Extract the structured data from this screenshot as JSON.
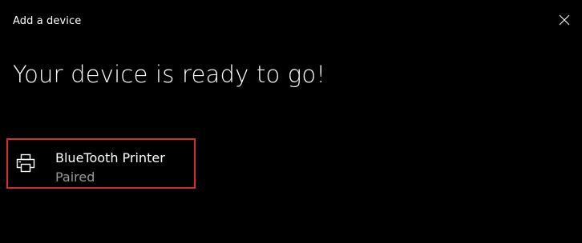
{
  "window": {
    "title": "Add a device",
    "close_icon": "close-icon"
  },
  "main": {
    "heading": "Your device is ready to go!"
  },
  "device": {
    "name": "BlueTooth Printer",
    "status": "Paired",
    "icon": "printer-icon",
    "highlight_color": "#d32f2f"
  },
  "colors": {
    "background": "#000000",
    "text_primary": "#ffffff",
    "text_secondary": "#9a9a9a"
  }
}
